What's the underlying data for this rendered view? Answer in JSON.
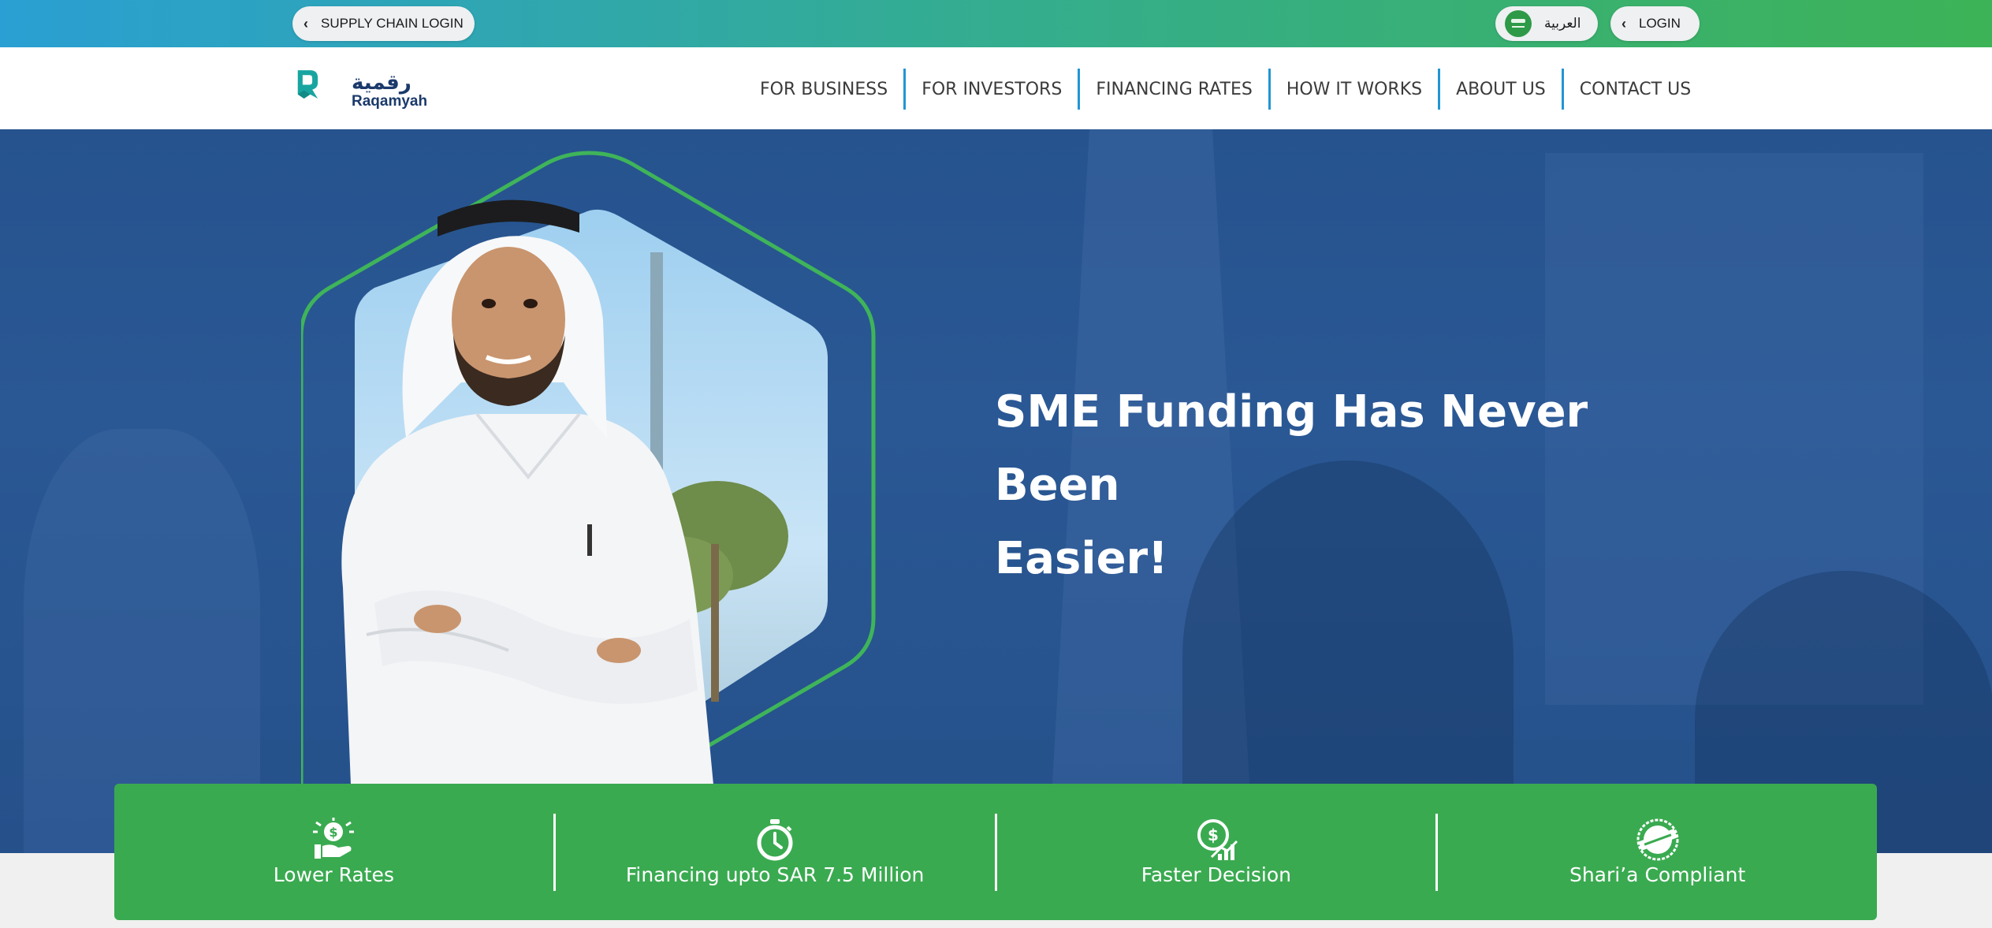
{
  "topbar": {
    "supply_chain_login": "SUPPLY CHAIN LOGIN",
    "language": "العربية",
    "login": "LOGIN"
  },
  "logo": {
    "arabic": "رقمية",
    "english": "Raqamyah"
  },
  "nav": {
    "items": [
      {
        "label": "FOR BUSINESS"
      },
      {
        "label": "FOR INVESTORS"
      },
      {
        "label": "FINANCING RATES"
      },
      {
        "label": "HOW IT WORKS"
      },
      {
        "label": "ABOUT US"
      },
      {
        "label": "CONTACT US"
      }
    ]
  },
  "hero": {
    "title_line1": "SME Funding Has Never Been",
    "title_line2": "Easier!"
  },
  "features": [
    {
      "icon": "money-hand-icon",
      "label": "Lower Rates"
    },
    {
      "icon": "stopwatch-icon",
      "label": "Financing upto SAR 7.5 Million"
    },
    {
      "icon": "dollar-growth-icon",
      "label": "Faster Decision"
    },
    {
      "icon": "compliant-stamp-icon",
      "label": "Shari’a Compliant"
    }
  ],
  "colors": {
    "topbar_start": "#2a9fd3",
    "topbar_end": "#3db357",
    "nav_separator": "#2196d3",
    "hero_blue": "#26538e",
    "feature_green": "#3aaa50",
    "brand_navy": "#1b3a6b",
    "brand_teal": "#18a5a0"
  }
}
